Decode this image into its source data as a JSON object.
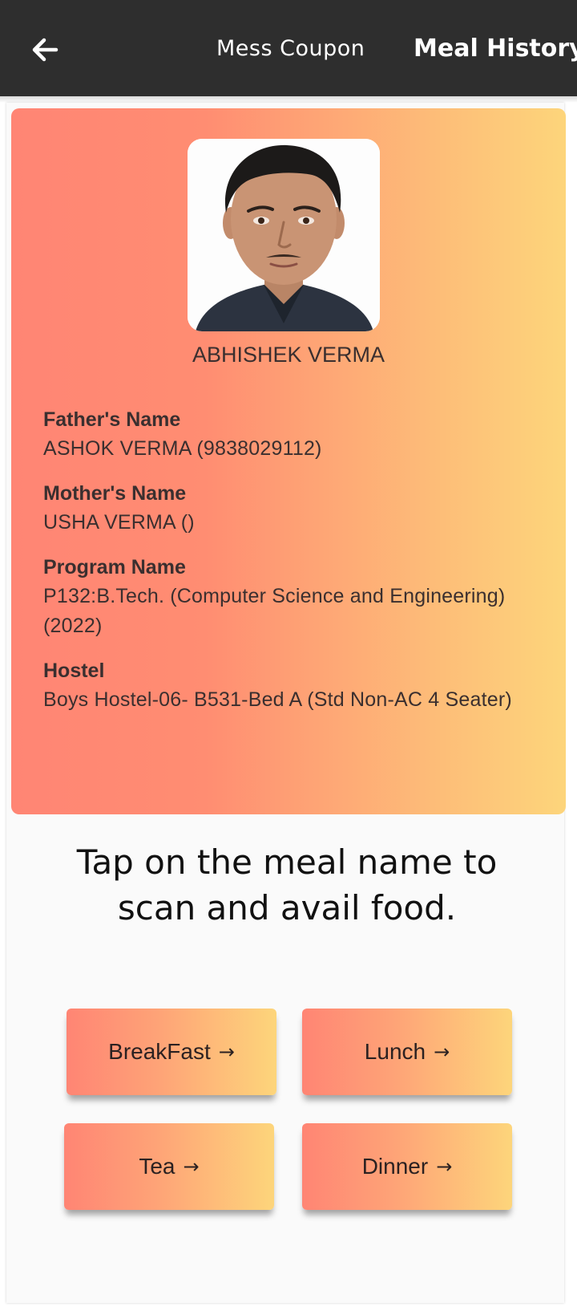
{
  "header": {
    "back_icon": "arrow-left-icon",
    "tabs": [
      {
        "label": "Mess Coupon"
      },
      {
        "label": "Meal History"
      }
    ]
  },
  "student": {
    "name": "ABHISHEK VERMA",
    "photo": "student-photo",
    "fields": [
      {
        "label": "Father's Name",
        "value": "ASHOK VERMA (9838029112)"
      },
      {
        "label": "Mother's Name",
        "value": "USHA VERMA ()"
      },
      {
        "label": "Program Name",
        "value": "P132:B.Tech. (Computer Science and Engineering) (2022)"
      },
      {
        "label": "Hostel",
        "value": "Boys Hostel-06- B531-Bed A (Std Non-AC 4 Seater)"
      }
    ]
  },
  "instruction": "Tap on the meal name to scan and avail food.",
  "meals": [
    {
      "label": "BreakFast",
      "arrow": "→"
    },
    {
      "label": "Lunch",
      "arrow": "→"
    },
    {
      "label": "Tea",
      "arrow": "→"
    },
    {
      "label": "Dinner",
      "arrow": "→"
    }
  ],
  "colors": {
    "topbar": "#2e2e2e",
    "gradient_start": "#ff8574",
    "gradient_end": "#fdd57b"
  }
}
